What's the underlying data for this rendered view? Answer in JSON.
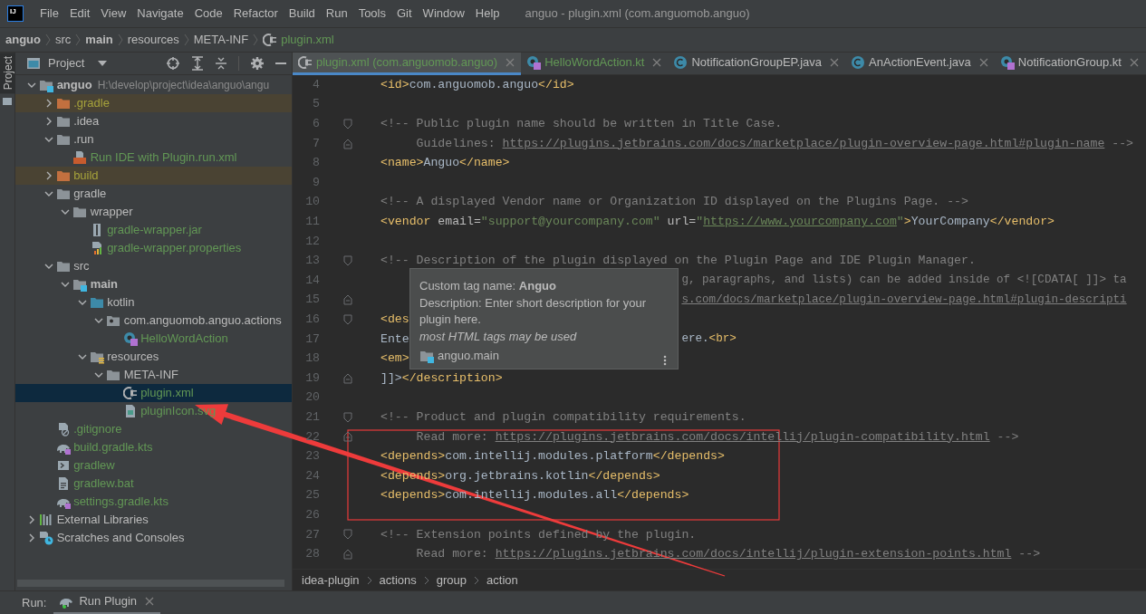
{
  "window": {
    "logo": "IJ",
    "menu": [
      "File",
      "Edit",
      "View",
      "Navigate",
      "Code",
      "Refactor",
      "Build",
      "Run",
      "Tools",
      "Git",
      "Window",
      "Help"
    ],
    "title": "anguo - plugin.xml (com.anguomob.anguo)"
  },
  "navigation_bar": [
    {
      "label": "anguo",
      "bold": true,
      "kind": "folder"
    },
    {
      "label": "src",
      "bold": false,
      "kind": "folder"
    },
    {
      "label": "main",
      "bold": true,
      "kind": "folder"
    },
    {
      "label": "resources",
      "bold": false,
      "kind": "folder"
    },
    {
      "label": "META-INF",
      "bold": false,
      "kind": "folder"
    },
    {
      "label": "plugin.xml",
      "bold": false,
      "kind": "plugin-file"
    }
  ],
  "tool_strip": {
    "tab": "Project",
    "selected": true
  },
  "project_panel": {
    "title": "Project",
    "tree": [
      {
        "label": "anguo",
        "path": "H:\\develop\\project\\idea\\anguo\\angu",
        "kind": "module-folder",
        "added": false,
        "excluded": false,
        "bold": true,
        "selected": false,
        "expanded": true,
        "children": [
          {
            "label": ".gradle",
            "kind": "folder",
            "added": false,
            "excluded": true,
            "bold": false,
            "selected": false,
            "expanded": false
          },
          {
            "label": ".idea",
            "kind": "folder",
            "added": false,
            "excluded": false,
            "bold": false,
            "selected": false,
            "expanded": false
          },
          {
            "label": ".run",
            "kind": "folder",
            "added": false,
            "excluded": false,
            "bold": false,
            "selected": false,
            "expanded": true,
            "children": [
              {
                "label": "Run IDE with Plugin.run.xml",
                "kind": "run-config-file",
                "added": true,
                "excluded": false,
                "bold": false,
                "selected": false
              }
            ]
          },
          {
            "label": "build",
            "kind": "folder",
            "added": false,
            "excluded": true,
            "bold": false,
            "selected": false,
            "expanded": false
          },
          {
            "label": "gradle",
            "kind": "folder",
            "added": false,
            "excluded": false,
            "bold": false,
            "selected": false,
            "expanded": true,
            "children": [
              {
                "label": "wrapper",
                "kind": "folder",
                "added": false,
                "excluded": false,
                "bold": false,
                "selected": false,
                "expanded": true,
                "children": [
                  {
                    "label": "gradle-wrapper.jar",
                    "kind": "jar-file",
                    "added": true,
                    "excluded": false,
                    "bold": false,
                    "selected": false
                  },
                  {
                    "label": "gradle-wrapper.properties",
                    "kind": "properties-file",
                    "added": true,
                    "excluded": false,
                    "bold": false,
                    "selected": false
                  }
                ]
              }
            ]
          },
          {
            "label": "src",
            "kind": "folder",
            "added": false,
            "excluded": false,
            "bold": false,
            "selected": false,
            "expanded": true,
            "children": [
              {
                "label": "main",
                "kind": "module-folder",
                "added": false,
                "excluded": false,
                "bold": true,
                "selected": false,
                "expanded": true,
                "children": [
                  {
                    "label": "kotlin",
                    "kind": "source-folder",
                    "added": false,
                    "excluded": false,
                    "bold": false,
                    "selected": false,
                    "expanded": true,
                    "children": [
                      {
                        "label": "com.anguomob.anguo.actions",
                        "kind": "package-folder",
                        "added": false,
                        "excluded": false,
                        "bold": false,
                        "selected": false,
                        "expanded": true,
                        "children": [
                          {
                            "label": "HelloWordAction",
                            "kind": "kotlin-class",
                            "added": true,
                            "excluded": false,
                            "bold": false,
                            "selected": false
                          }
                        ]
                      }
                    ]
                  },
                  {
                    "label": "resources",
                    "kind": "resources-folder",
                    "added": false,
                    "excluded": false,
                    "bold": false,
                    "selected": false,
                    "expanded": true,
                    "children": [
                      {
                        "label": "META-INF",
                        "kind": "folder",
                        "added": false,
                        "excluded": false,
                        "bold": false,
                        "selected": false,
                        "expanded": true,
                        "children": [
                          {
                            "label": "plugin.xml",
                            "kind": "plugin-file",
                            "added": true,
                            "excluded": false,
                            "bold": false,
                            "selected": true
                          },
                          {
                            "label": "pluginIcon.svg",
                            "kind": "image-file",
                            "added": true,
                            "excluded": false,
                            "bold": false,
                            "selected": false
                          }
                        ]
                      }
                    ]
                  }
                ]
              }
            ]
          },
          {
            "label": ".gitignore",
            "kind": "ignore-file",
            "added": true,
            "excluded": false,
            "bold": false,
            "selected": false
          },
          {
            "label": "build.gradle.kts",
            "kind": "gradle-file",
            "added": true,
            "excluded": false,
            "bold": false,
            "selected": false
          },
          {
            "label": "gradlew",
            "kind": "shell-file",
            "added": true,
            "excluded": false,
            "bold": false,
            "selected": false
          },
          {
            "label": "gradlew.bat",
            "kind": "text-file",
            "added": true,
            "excluded": false,
            "bold": false,
            "selected": false
          },
          {
            "label": "settings.gradle.kts",
            "kind": "gradle-file",
            "added": true,
            "excluded": false,
            "bold": false,
            "selected": false
          }
        ]
      },
      {
        "label": "External Libraries",
        "kind": "libraries",
        "added": false,
        "excluded": false,
        "bold": false,
        "selected": false,
        "expanded": false
      },
      {
        "label": "Scratches and Consoles",
        "kind": "scratches",
        "added": false,
        "excluded": false,
        "bold": false,
        "selected": false,
        "expanded": false
      }
    ]
  },
  "editor": {
    "tabs": [
      {
        "label": "plugin.xml (com.anguomob.anguo)",
        "kind": "plugin-file",
        "added": true,
        "selected": true
      },
      {
        "label": "HelloWordAction.kt",
        "kind": "kotlin-class",
        "added": true,
        "selected": false
      },
      {
        "label": "NotificationGroupEP.java",
        "kind": "java-class",
        "added": false,
        "selected": false
      },
      {
        "label": "AnActionEvent.java",
        "kind": "java-class",
        "added": false,
        "selected": false
      },
      {
        "label": "NotificationGroup.kt",
        "kind": "kotlin-class",
        "added": false,
        "selected": false
      }
    ],
    "lines": [
      {
        "number": "4",
        "fold_start": false,
        "fold_end": false,
        "tokens": [
          {
            "kind": "tag",
            "text": "<id>"
          },
          {
            "kind": "text",
            "text": "com.anguomob.anguo"
          },
          {
            "kind": "tag",
            "text": "</id>"
          }
        ]
      },
      {
        "number": "5",
        "fold_start": false,
        "fold_end": false
      },
      {
        "number": "6",
        "fold_start": true,
        "fold_end": false,
        "tokens": [
          {
            "kind": "comment",
            "text": "<!-- Public plugin name should be written in Title Case."
          }
        ]
      },
      {
        "number": "7",
        "fold_start": false,
        "fold_end": true,
        "tokens": [
          {
            "kind": "comment",
            "text": "     Guidelines: "
          },
          {
            "kind": "comment-link",
            "text": "https://plugins.jetbrains.com/docs/marketplace/plugin-overview-page.html#plugin-name"
          },
          {
            "kind": "comment",
            "text": " -->"
          }
        ]
      },
      {
        "number": "8",
        "fold_start": false,
        "fold_end": false,
        "tokens": [
          {
            "kind": "tag",
            "text": "<name>"
          },
          {
            "kind": "text",
            "text": "Anguo"
          },
          {
            "kind": "tag",
            "text": "</name>"
          }
        ]
      },
      {
        "number": "9",
        "fold_start": false,
        "fold_end": false
      },
      {
        "number": "10",
        "fold_start": false,
        "fold_end": false,
        "tokens": [
          {
            "kind": "comment",
            "text": "<!-- A displayed Vendor name or Organization ID displayed on the Plugins Page. -->"
          }
        ]
      },
      {
        "number": "11",
        "fold_start": false,
        "fold_end": false,
        "tokens": [
          {
            "kind": "tag",
            "text": "<vendor"
          },
          {
            "kind": "attr",
            "text": " email="
          },
          {
            "kind": "string",
            "text": "\"support@yourcompany.com\""
          },
          {
            "kind": "attr",
            "text": " url="
          },
          {
            "kind": "string",
            "text": "\""
          },
          {
            "kind": "string-link",
            "text": "https://www.yourcompany.com"
          },
          {
            "kind": "string",
            "text": "\""
          },
          {
            "kind": "tag",
            "text": ">"
          },
          {
            "kind": "text",
            "text": "YourCompany"
          },
          {
            "kind": "tag",
            "text": "</vendor>"
          }
        ]
      },
      {
        "number": "12",
        "fold_start": false,
        "fold_end": false
      },
      {
        "number": "13",
        "fold_start": true,
        "fold_end": false,
        "tokens": [
          {
            "kind": "comment",
            "text": "<!-- Description of the plugin displayed on the Plugin Page and IDE Plugin Manager."
          }
        ]
      },
      {
        "number": "14",
        "fold_start": false,
        "fold_end": false,
        "tokens_after": [
          {
            "kind": "comment",
            "text": "g, paragraphs, and lists) can be added inside of <![CDATA[ ]]> ta"
          }
        ]
      },
      {
        "number": "15",
        "fold_start": false,
        "fold_end": true,
        "tokens_after": [
          {
            "kind": "comment-link",
            "text": "s.com/docs/marketplace/plugin-overview-page.html#plugin-descripti"
          }
        ]
      },
      {
        "number": "16",
        "fold_start": true,
        "fold_end": false,
        "tokens": [
          {
            "kind": "tag",
            "text": "<des"
          }
        ]
      },
      {
        "number": "17",
        "fold_start": false,
        "fold_end": false,
        "tokens": [
          {
            "kind": "text",
            "text": "Ente"
          }
        ],
        "tokens_after": [
          {
            "kind": "text",
            "text": "ere."
          },
          {
            "kind": "tag",
            "text": "<br>"
          }
        ]
      },
      {
        "number": "18",
        "fold_start": false,
        "fold_end": false,
        "tokens": [
          {
            "kind": "tag",
            "text": "<em>"
          }
        ]
      },
      {
        "number": "19",
        "fold_start": false,
        "fold_end": true,
        "tokens": [
          {
            "kind": "text",
            "text": "]]>"
          },
          {
            "kind": "tag",
            "text": "</description>"
          }
        ]
      },
      {
        "number": "20",
        "fold_start": false,
        "fold_end": false
      },
      {
        "number": "21",
        "fold_start": true,
        "fold_end": false,
        "tokens": [
          {
            "kind": "comment",
            "text": "<!-- Product and plugin compatibility requirements."
          }
        ]
      },
      {
        "number": "22",
        "fold_start": false,
        "fold_end": true,
        "tokens": [
          {
            "kind": "comment",
            "text": "     Read more: "
          },
          {
            "kind": "comment-link",
            "text": "https://plugins.jetbrains.com/docs/intellij/plugin-compatibility.html"
          },
          {
            "kind": "comment",
            "text": " -->"
          }
        ]
      },
      {
        "number": "23",
        "fold_start": false,
        "fold_end": false,
        "tokens": [
          {
            "kind": "tag",
            "text": "<depends>"
          },
          {
            "kind": "text",
            "text": "com.intellij.modules.platform"
          },
          {
            "kind": "tag",
            "text": "</depends>"
          }
        ]
      },
      {
        "number": "24",
        "fold_start": false,
        "fold_end": false,
        "tokens": [
          {
            "kind": "tag",
            "text": "<depends>"
          },
          {
            "kind": "text",
            "text": "org.jetbrains.kotlin"
          },
          {
            "kind": "tag",
            "text": "</depends>"
          }
        ]
      },
      {
        "number": "25",
        "fold_start": false,
        "fold_end": false,
        "tokens": [
          {
            "kind": "tag",
            "text": "<depends>"
          },
          {
            "kind": "text",
            "text": "com.intellij.modules.all"
          },
          {
            "kind": "tag",
            "text": "</depends>"
          }
        ]
      },
      {
        "number": "26",
        "fold_start": false,
        "fold_end": false
      },
      {
        "number": "27",
        "fold_start": true,
        "fold_end": false,
        "tokens": [
          {
            "kind": "comment",
            "text": "<!-- Extension points defined by the plugin."
          }
        ]
      },
      {
        "number": "28",
        "fold_start": false,
        "fold_end": true,
        "tokens": [
          {
            "kind": "comment",
            "text": "     Read more: "
          },
          {
            "kind": "comment-link",
            "text": "https://plugins.jetbrains.com/docs/intellij/plugin-extension-points.html"
          },
          {
            "kind": "comment",
            "text": " -->"
          }
        ]
      }
    ],
    "breadcrumbs": [
      "idea-plugin",
      "actions",
      "group",
      "action"
    ]
  },
  "tooltip": {
    "heading": "Custom tag name: **Anguo**",
    "description": "Description: Enter short description for your plugin here.",
    "note": "most HTML tags may be used",
    "module": "anguo.main"
  },
  "run_bar": {
    "label": "Run:",
    "tabs": [
      {
        "label": "Run Plugin",
        "selected": true
      }
    ]
  }
}
